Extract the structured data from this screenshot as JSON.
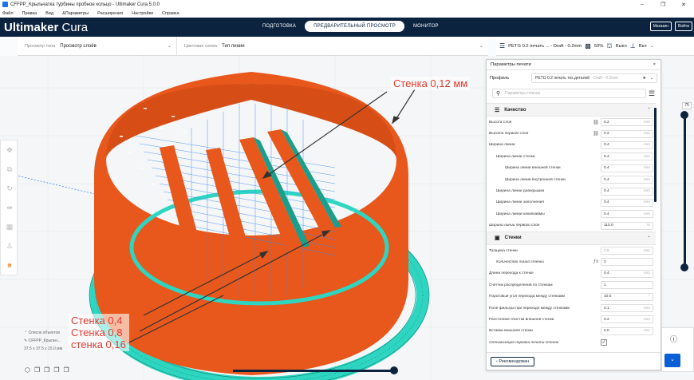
{
  "window": {
    "title": "CFFPP_Крыльчатка турбины пробное кольцо - Ultimaker Cura 5.0.0",
    "controls": [
      "–",
      "❐",
      "✕"
    ]
  },
  "menu": [
    "Файл",
    "Правка",
    "Вид",
    "&Параметры",
    "Расширения",
    "Настройки",
    "Справка"
  ],
  "header": {
    "logo_bold": "Ultimaker",
    "logo_thin": " Cura",
    "stages": [
      "ПОДГОТОВКА",
      "ПРЕДВАРИТЕЛЬНЫЙ ПРОСМОТР",
      "МОНИТОР"
    ],
    "active_stage": 1,
    "buttons": [
      "Магазин",
      "Войти"
    ]
  },
  "viewbar": {
    "view_type_label": "Просмотр типа",
    "view_type_value": "Просмотр слоёв",
    "color_scheme_label": "Цветовая схема",
    "color_scheme_value": "Тип линии"
  },
  "settings_summary": {
    "profile": "PETG 0.2 печать ... - Draft - 0.2mm",
    "infill": "50%",
    "support": "Выкл",
    "adhesion": "Вкл"
  },
  "annotations": {
    "top": "Стенка 0,12 мм",
    "bottom_left": [
      "Стенка 0,4",
      "Стенка 0,8",
      "стенка 0,16"
    ]
  },
  "panel": {
    "title": "Параметры печати",
    "close": "×",
    "profile_label": "Профиль",
    "profile_value": "PETG 0.2 печать тех.деталей",
    "profile_suffix": "- Draft - 0.2mm",
    "search_placeholder": "Параметры поиска",
    "categories": {
      "quality": "Качество",
      "walls": "Стенки"
    },
    "quality_rows": [
      {
        "label": "Высота слоя",
        "indent": 0,
        "italic": false,
        "icon": "link",
        "value": "0.2",
        "unit": "mm"
      },
      {
        "label": "Высота первого слоя",
        "indent": 0,
        "italic": true,
        "icon": "link",
        "value": "0.2",
        "unit": "mm"
      },
      {
        "label": "Ширина линии",
        "indent": 0,
        "italic": false,
        "icon": "",
        "value": "0.4",
        "unit": "mm"
      },
      {
        "label": "Ширина линии стенки",
        "indent": 1,
        "italic": false,
        "icon": "",
        "value": "0.4",
        "unit": "mm"
      },
      {
        "label": "Ширина линии внешней стенки",
        "indent": 2,
        "italic": false,
        "icon": "",
        "value": "0.4",
        "unit": "mm"
      },
      {
        "label": "Ширина линии внутренней стенки",
        "indent": 2,
        "italic": false,
        "icon": "",
        "value": "0.4",
        "unit": "mm"
      },
      {
        "label": "Ширина линии дна/крышки",
        "indent": 1,
        "italic": false,
        "icon": "",
        "value": "0.4",
        "unit": "mm"
      },
      {
        "label": "Ширина линии заполнения",
        "indent": 1,
        "italic": false,
        "icon": "",
        "value": "0.4",
        "unit": "mm"
      },
      {
        "label": "Ширина линии юбки/каймы",
        "indent": 1,
        "italic": false,
        "icon": "",
        "value": "0.4",
        "unit": "mm"
      },
      {
        "label": "Ширина линии первого слоя",
        "indent": 0,
        "italic": true,
        "icon": "",
        "value": "110.0",
        "unit": "%"
      }
    ],
    "wall_rows": [
      {
        "label": "Толщина стенки",
        "indent": 0,
        "italic": false,
        "icon": "",
        "value": "0.8",
        "unit": "mm",
        "grey": true
      },
      {
        "label": "Количество линий стенки",
        "indent": 1,
        "italic": true,
        "icon": "fx",
        "value": "3",
        "unit": ""
      },
      {
        "label": "Длина перехода к стенке",
        "indent": 0,
        "italic": false,
        "icon": "",
        "value": "0.4",
        "unit": "mm"
      },
      {
        "label": "Счетчик распределений по стенкам",
        "indent": 0,
        "italic": false,
        "icon": "",
        "value": "1",
        "unit": ""
      },
      {
        "label": "Пороговый угол перехода между стенками",
        "indent": 0,
        "italic": false,
        "icon": "",
        "value": "10.0",
        "unit": "°"
      },
      {
        "label": "Поле фильтра при переходе между стенками",
        "indent": 0,
        "italic": false,
        "icon": "",
        "value": "0.1",
        "unit": "mm"
      },
      {
        "label": "Расстояние очистки внешней стенки",
        "indent": 0,
        "italic": false,
        "icon": "",
        "value": "0.2",
        "unit": "mm"
      },
      {
        "label": "Вставка внешней стенки",
        "indent": 0,
        "italic": false,
        "icon": "",
        "value": "0.0",
        "unit": "mm"
      },
      {
        "label": "Оптимизация порядка печати стенок",
        "indent": 0,
        "italic": true,
        "icon": "",
        "value": "✓",
        "unit": "",
        "checkbox": true
      }
    ],
    "recommended_button": "Рекомендован"
  },
  "layer_slider": {
    "value": "75"
  },
  "objects": {
    "list_label": "Список объектов",
    "item_name": "CFFPP_Крыльч...",
    "dimensions": "37.5 x 37.5 x 15.0 мм"
  },
  "colors": {
    "header_bg": "#0c2340",
    "wall_orange": "#e8571c",
    "skirt_teal": "#2ed6c2",
    "travel_blue": "#3a8ef6",
    "annotation_red": "#e5392f"
  }
}
